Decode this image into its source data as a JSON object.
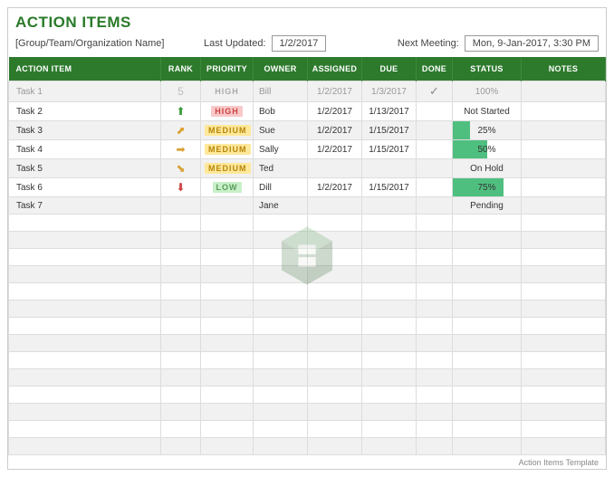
{
  "title": "ACTION ITEMS",
  "group_placeholder": "[Group/Team/Organization Name]",
  "last_updated_label": "Last Updated:",
  "last_updated_value": "1/2/2017",
  "next_meeting_label": "Next Meeting:",
  "next_meeting_value": "Mon, 9-Jan-2017, 3:30 PM",
  "headers": {
    "action": "ACTION ITEM",
    "rank": "RANK",
    "priority": "PRIORITY",
    "owner": "OWNER",
    "assigned": "ASSIGNED",
    "due": "DUE",
    "done": "DONE",
    "status": "STATUS",
    "notes": "NOTES"
  },
  "priority_labels": {
    "high": "HIGH",
    "medium": "MEDIUM",
    "low": "LOW"
  },
  "rows": [
    {
      "action": "Task 1",
      "rank": "5",
      "rank_type": "done",
      "priority": "high",
      "priority_done": true,
      "owner": "Bill",
      "assigned": "1/2/2017",
      "due": "1/3/2017",
      "done": true,
      "status_pct": 100,
      "status_text": "100%"
    },
    {
      "action": "Task 2",
      "rank_type": "up",
      "priority": "high",
      "owner": "Bob",
      "assigned": "1/2/2017",
      "due": "1/13/2017",
      "status_text": "Not Started"
    },
    {
      "action": "Task 3",
      "rank_type": "upright",
      "priority": "medium",
      "owner": "Sue",
      "assigned": "1/2/2017",
      "due": "1/15/2017",
      "status_pct": 25,
      "status_text": "25%"
    },
    {
      "action": "Task 4",
      "rank_type": "right",
      "priority": "medium",
      "owner": "Sally",
      "assigned": "1/2/2017",
      "due": "1/15/2017",
      "status_pct": 50,
      "status_text": "50%"
    },
    {
      "action": "Task 5",
      "rank_type": "downright",
      "priority": "medium",
      "owner": "Ted",
      "status_text": "On Hold"
    },
    {
      "action": "Task 6",
      "rank_type": "down",
      "priority": "low",
      "owner": "Dill",
      "assigned": "1/2/2017",
      "due": "1/15/2017",
      "status_pct": 75,
      "status_text": "75%"
    },
    {
      "action": "Task 7",
      "owner": "Jane",
      "status_text": "Pending"
    }
  ],
  "empty_row_count": 14,
  "footer": "Action Items Template",
  "rank_glyphs": {
    "up": "⬆",
    "upright": "⬈",
    "right": "➡",
    "downright": "⬊",
    "down": "⬇"
  },
  "done_glyph": "✓"
}
